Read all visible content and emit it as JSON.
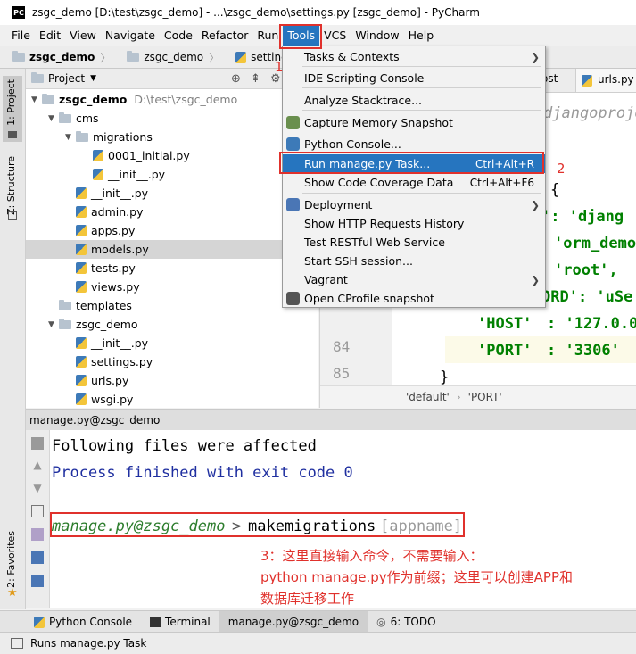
{
  "window": {
    "title": "zsgc_demo [D:\\test\\zsgc_demo] - ...\\zsgc_demo\\settings.py [zsgc_demo] - PyCharm"
  },
  "menubar": {
    "items": [
      "File",
      "Edit",
      "View",
      "Navigate",
      "Code",
      "Refactor",
      "Run",
      "Tools",
      "VCS",
      "Window",
      "Help"
    ],
    "active": "Tools"
  },
  "breadcrumb": [
    "zsgc_demo",
    "zsgc_demo",
    "settings.py"
  ],
  "left_strip": {
    "project_tab": "1: Project",
    "structure_tab": "Z: Structure",
    "favorites_tab": "2: Favorites"
  },
  "project_panel": {
    "header": "Project",
    "tree": [
      {
        "label": "zsgc_demo",
        "extra": "D:\\test\\zsgc_demo",
        "type": "folder",
        "level": 0,
        "expanded": true
      },
      {
        "label": "cms",
        "type": "folder",
        "level": 1,
        "expanded": true
      },
      {
        "label": "migrations",
        "type": "folder",
        "level": 2,
        "expanded": true
      },
      {
        "label": "0001_initial.py",
        "type": "py",
        "level": 3
      },
      {
        "label": "__init__.py",
        "type": "py",
        "level": 3
      },
      {
        "label": "__init__.py",
        "type": "py",
        "level": 2
      },
      {
        "label": "admin.py",
        "type": "py",
        "level": 2
      },
      {
        "label": "apps.py",
        "type": "py",
        "level": 2
      },
      {
        "label": "models.py",
        "type": "py",
        "level": 2,
        "selected": true
      },
      {
        "label": "tests.py",
        "type": "py",
        "level": 2
      },
      {
        "label": "views.py",
        "type": "py",
        "level": 2
      },
      {
        "label": "templates",
        "type": "folder",
        "level": 1
      },
      {
        "label": "zsgc_demo",
        "type": "folder",
        "level": 1,
        "expanded": true
      },
      {
        "label": "__init__.py",
        "type": "py",
        "level": 2
      },
      {
        "label": "settings.py",
        "type": "py",
        "level": 2
      },
      {
        "label": "urls.py",
        "type": "py",
        "level": 2
      },
      {
        "label": "wsgi.py",
        "type": "py",
        "level": 2
      }
    ]
  },
  "editor": {
    "tabs": [
      "ost",
      "urls.py"
    ],
    "comment_fragment": "djangoproje",
    "line_numbers": [
      "84",
      "85",
      "86"
    ],
    "code": {
      "l1": "{",
      "l2a": "': 'djang",
      "l3": "'orm_demo",
      "l4": "'root',",
      "l5a": "ORD': 'uSe",
      "l84a": "'HOST'",
      "l84b": ": '127.0.0.",
      "l85a": "'PORT'",
      "l85b": ": '3306'",
      "l86": "}"
    },
    "footer": [
      "'default'",
      "'PORT'"
    ]
  },
  "tools_menu": {
    "items": [
      {
        "label": "Tasks & Contexts",
        "submenu": true
      },
      {
        "label": "IDE Scripting Console"
      },
      {
        "label": "Analyze Stacktrace..."
      },
      {
        "label": "Capture Memory Snapshot",
        "icon": "memory-icon"
      },
      {
        "label": "Python Console...",
        "icon": "python-icon"
      },
      {
        "label": "Run manage.py Task...",
        "shortcut": "Ctrl+Alt+R",
        "highlighted": true
      },
      {
        "label": "Show Code Coverage Data",
        "shortcut": "Ctrl+Alt+F6"
      },
      {
        "label": "Deployment",
        "submenu": true,
        "icon": "deployment-icon"
      },
      {
        "label": "Show HTTP Requests History"
      },
      {
        "label": "Test RESTful Web Service"
      },
      {
        "label": "Start SSH session..."
      },
      {
        "label": "Vagrant",
        "submenu": true
      },
      {
        "label": "Open CProfile snapshot",
        "icon": "cprofile-icon"
      }
    ]
  },
  "run_panel": {
    "title": "manage.py@zsgc_demo",
    "output": [
      "Following files were affected",
      "Process finished with exit code 0"
    ],
    "prompt": "manage.py@zsgc_demo",
    "prompt_sep": ">",
    "command": "makemigrations",
    "hint": "[appname]"
  },
  "annotations": {
    "n1": "1",
    "n2": "2",
    "n3_line1": "3：这里直接输入命令，不需要输入：",
    "n3_line2": "python manage.py作为前缀；这里可以创建APP和",
    "n3_line3": "数据库迁移工作"
  },
  "bottom_tabs": [
    "Python Console",
    "Terminal",
    "manage.py@zsgc_demo",
    "6: TODO"
  ],
  "status": "Runs manage.py Task",
  "colors": {
    "accent": "#2675bf",
    "annotation": "#e0312c",
    "prompt_green": "#2d7d2d",
    "console_blue": "#1f2fa0"
  }
}
